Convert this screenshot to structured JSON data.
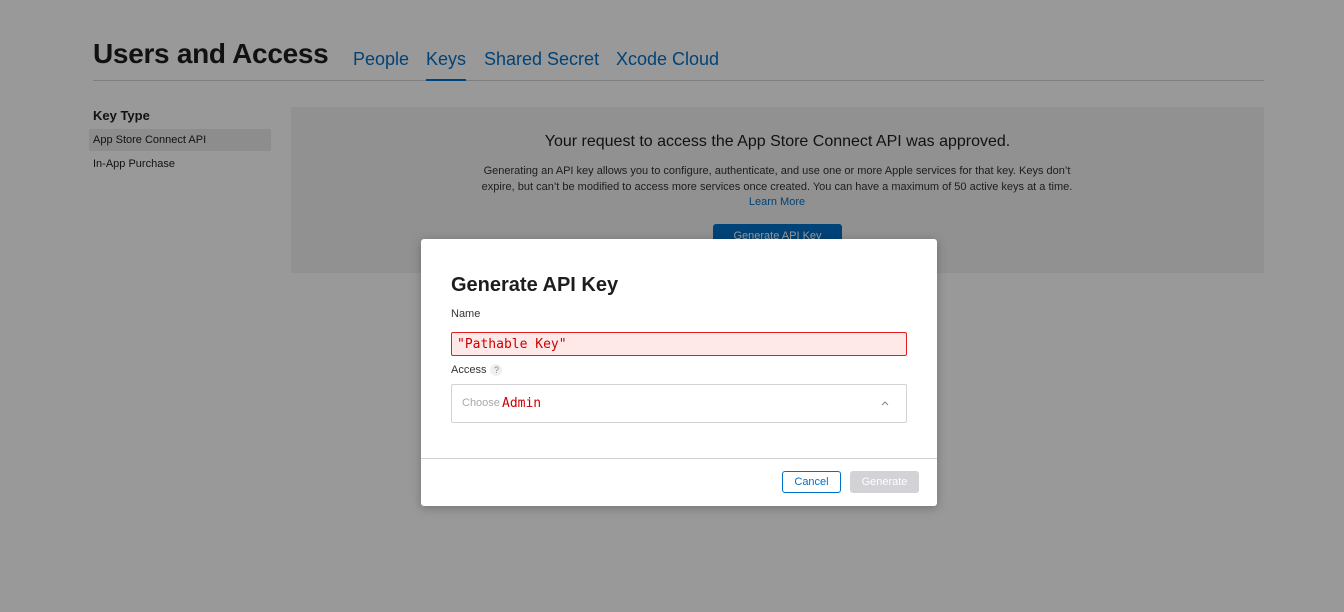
{
  "header": {
    "title": "Users and Access",
    "tabs": [
      {
        "label": "People"
      },
      {
        "label": "Keys",
        "active": true
      },
      {
        "label": "Shared Secret"
      },
      {
        "label": "Xcode Cloud"
      }
    ]
  },
  "sidebar": {
    "heading": "Key Type",
    "items": [
      {
        "label": "App Store Connect API",
        "selected": true
      },
      {
        "label": "In-App Purchase"
      }
    ]
  },
  "main": {
    "heading": "Your request to access the App Store Connect API was approved.",
    "description": "Generating an API key allows you to configure, authenticate, and use one or more Apple services for that key. Keys don’t expire, but can’t be modified to access more services once created. You can have a maximum of 50 active keys at a time.",
    "learn_more": "Learn More",
    "generate_button": "Generate API Key"
  },
  "modal": {
    "title": "Generate API Key",
    "name_label": "Name",
    "name_value": "\"Pathable Key\"",
    "access_label": "Access",
    "access_help": "?",
    "access_placeholder": "Choose",
    "access_value": "Admin",
    "cancel_label": "Cancel",
    "generate_label": "Generate"
  },
  "colors": {
    "accent": "#0070c9",
    "error": "#e02020",
    "overlay": "rgba(0,0,0,0.4)"
  },
  "icons": {
    "select_chevron": "chevron-up-icon",
    "help": "question-mark-icon"
  }
}
